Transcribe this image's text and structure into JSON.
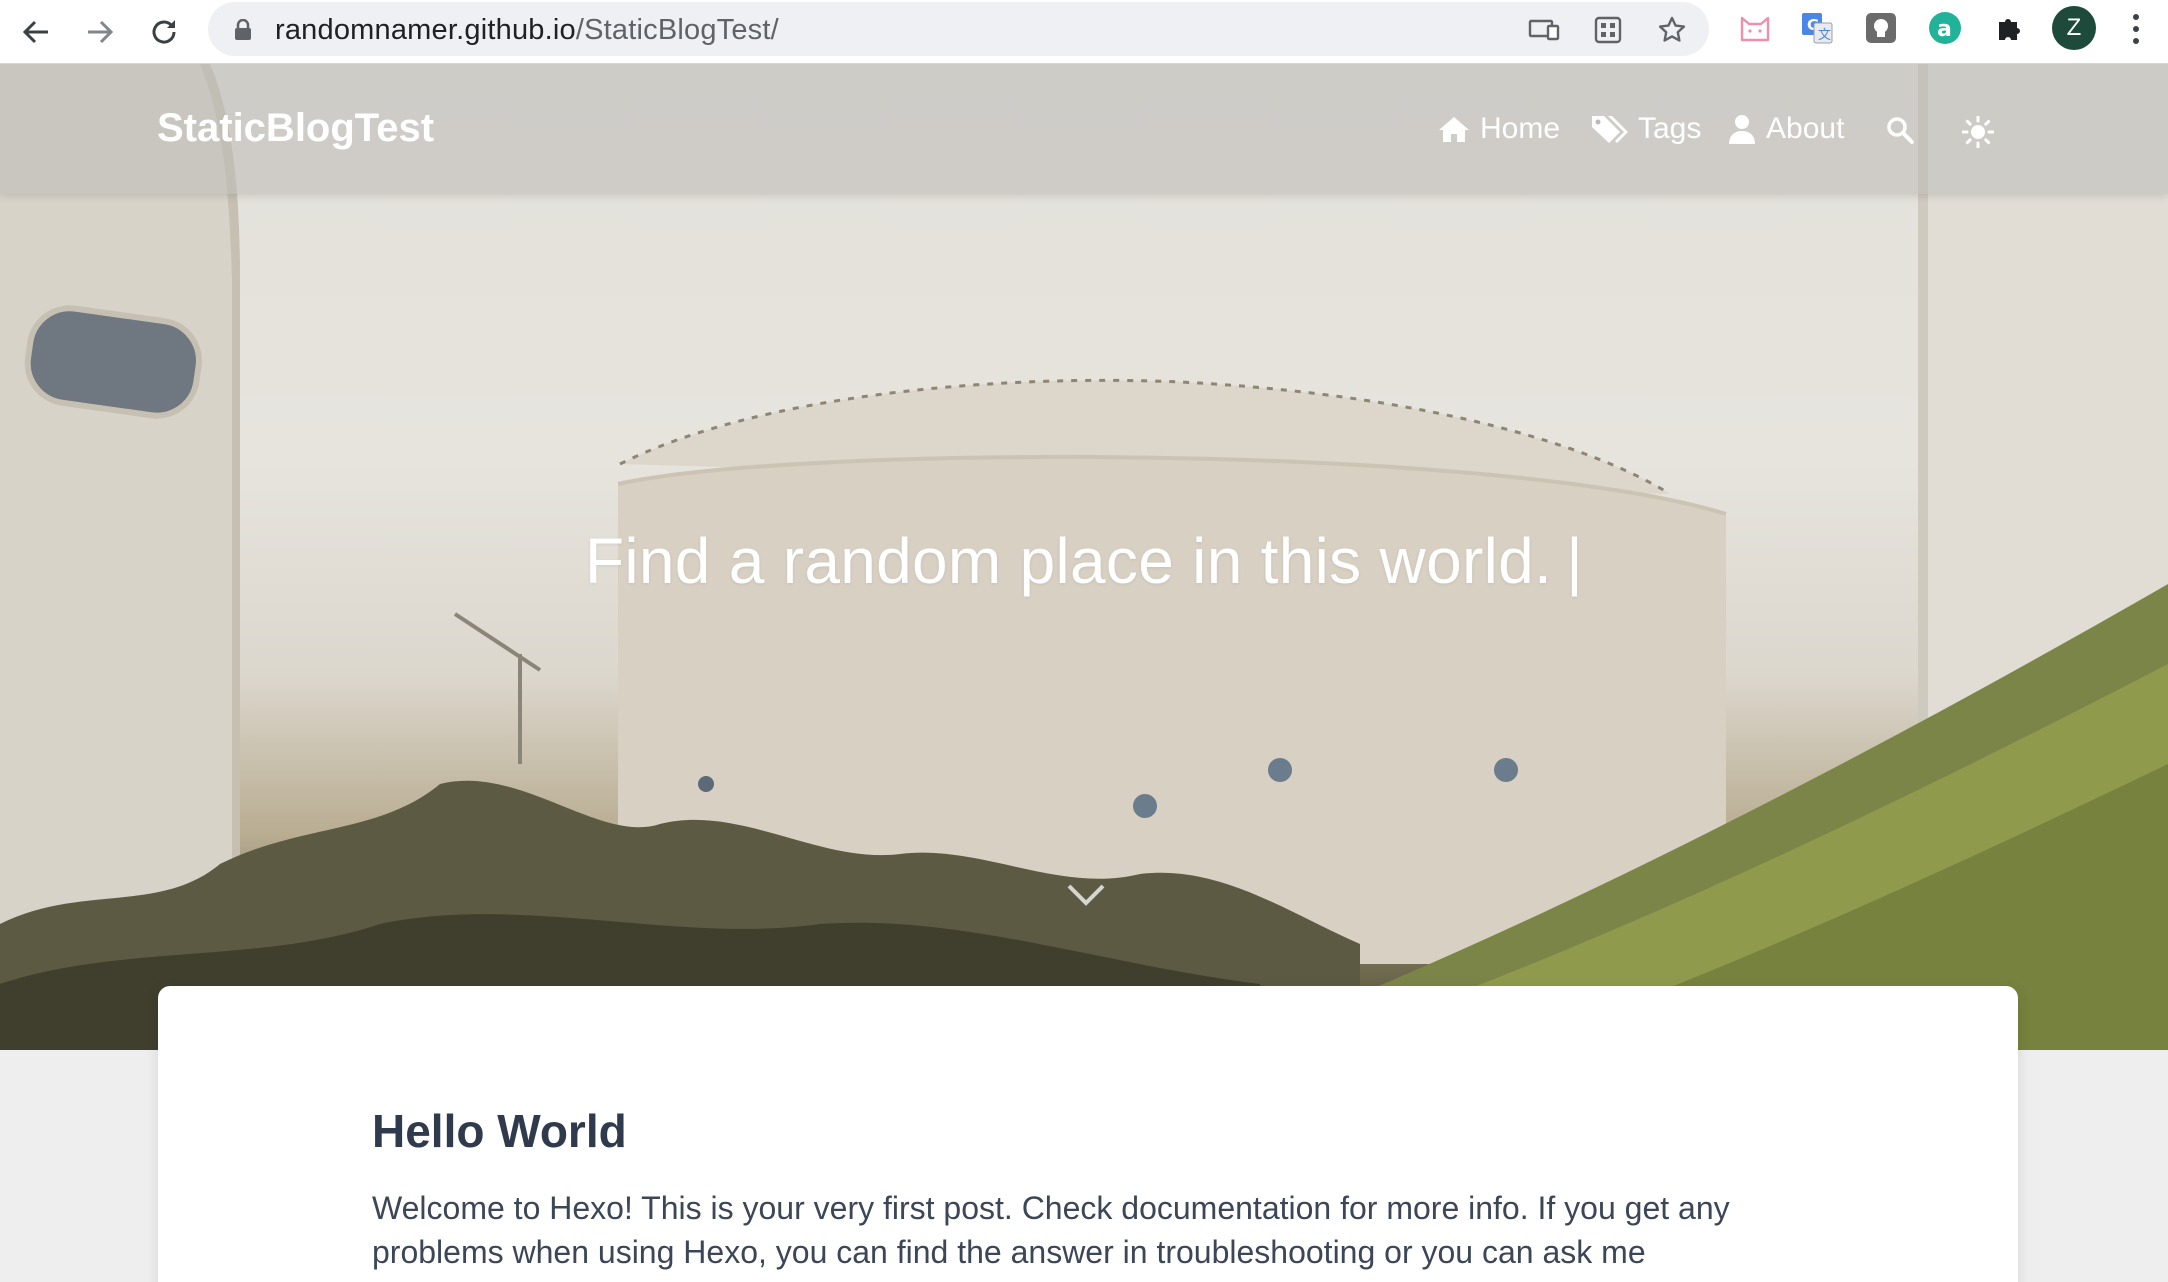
{
  "browser": {
    "url_host": "randomnamer.github.io",
    "url_path": "/StaticBlogTest/",
    "avatar_initial": "Z",
    "icons": [
      "back-icon",
      "forward-icon",
      "reload-icon",
      "lock-icon",
      "cast-icon",
      "qr-code-icon",
      "bookmark-star-icon",
      "cat-extension-icon",
      "translate-extension-icon",
      "grey-extension-icon",
      "green-a-extension-icon",
      "puzzle-extensions-icon",
      "profile-avatar",
      "more-menu-icon"
    ],
    "accent_colors": {
      "avatar": "#1d4a3a",
      "omnibox": "#eef0f3"
    }
  },
  "site": {
    "brand": "StaticBlogTest",
    "nav": [
      {
        "label": "Home",
        "icon": "home-icon"
      },
      {
        "label": "Tags",
        "icon": "tags-icon"
      },
      {
        "label": "About",
        "icon": "user-icon"
      }
    ],
    "search_icon": "search-icon",
    "theme_icon": "sun-icon"
  },
  "hero": {
    "slogan": "Find a random place in this world.",
    "caret": "|",
    "scroll_icon": "chevron-down-icon"
  },
  "post": {
    "title": "Hello World",
    "excerpt": "Welcome to Hexo! This is your very first post. Check documentation for more info. If you get any problems when using Hexo, you can find the answer in troubleshooting or you can ask me"
  },
  "colors": {
    "title_text": "#2f3b4c",
    "body_text": "#3c4656",
    "page_bg": "#eeeeee"
  }
}
